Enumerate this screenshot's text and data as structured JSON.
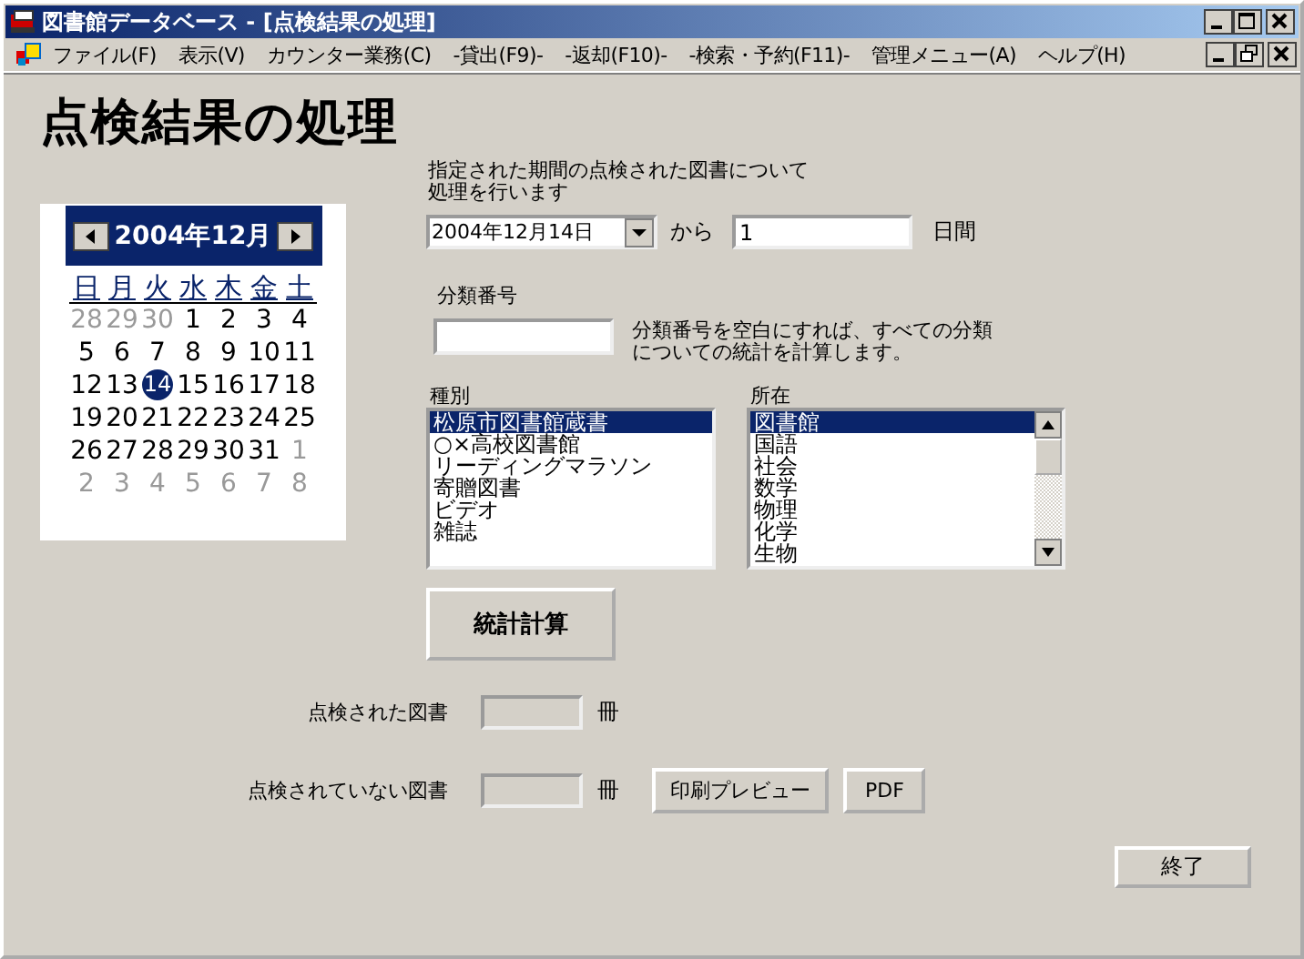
{
  "window": {
    "title": "図書館データベース - [点検結果の処理]"
  },
  "menu": [
    "ファイル(F)",
    "表示(V)",
    "カウンター業務(C)",
    "-貸出(F9)-",
    "-返却(F10)-",
    "-検索・予約(F11)-",
    "管理メニュー(A)",
    "ヘルプ(H)"
  ],
  "heading": "点検結果の処理",
  "calendar": {
    "title": "2004年12月",
    "weekdays": [
      "日",
      "月",
      "火",
      "水",
      "木",
      "金",
      "土"
    ],
    "weeks": [
      [
        {
          "day": "28",
          "muted": true,
          "selected": false
        },
        {
          "day": "29",
          "muted": true,
          "selected": false
        },
        {
          "day": "30",
          "muted": true,
          "selected": false
        },
        {
          "day": "1",
          "muted": false,
          "selected": false
        },
        {
          "day": "2",
          "muted": false,
          "selected": false
        },
        {
          "day": "3",
          "muted": false,
          "selected": false
        },
        {
          "day": "4",
          "muted": false,
          "selected": false
        }
      ],
      [
        {
          "day": "5",
          "muted": false,
          "selected": false
        },
        {
          "day": "6",
          "muted": false,
          "selected": false
        },
        {
          "day": "7",
          "muted": false,
          "selected": false
        },
        {
          "day": "8",
          "muted": false,
          "selected": false
        },
        {
          "day": "9",
          "muted": false,
          "selected": false
        },
        {
          "day": "10",
          "muted": false,
          "selected": false
        },
        {
          "day": "11",
          "muted": false,
          "selected": false
        }
      ],
      [
        {
          "day": "12",
          "muted": false,
          "selected": false
        },
        {
          "day": "13",
          "muted": false,
          "selected": false
        },
        {
          "day": "14",
          "muted": false,
          "selected": true
        },
        {
          "day": "15",
          "muted": false,
          "selected": false
        },
        {
          "day": "16",
          "muted": false,
          "selected": false
        },
        {
          "day": "17",
          "muted": false,
          "selected": false
        },
        {
          "day": "18",
          "muted": false,
          "selected": false
        }
      ],
      [
        {
          "day": "19",
          "muted": false,
          "selected": false
        },
        {
          "day": "20",
          "muted": false,
          "selected": false
        },
        {
          "day": "21",
          "muted": false,
          "selected": false
        },
        {
          "day": "22",
          "muted": false,
          "selected": false
        },
        {
          "day": "23",
          "muted": false,
          "selected": false
        },
        {
          "day": "24",
          "muted": false,
          "selected": false
        },
        {
          "day": "25",
          "muted": false,
          "selected": false
        }
      ],
      [
        {
          "day": "26",
          "muted": false,
          "selected": false
        },
        {
          "day": "27",
          "muted": false,
          "selected": false
        },
        {
          "day": "28",
          "muted": false,
          "selected": false
        },
        {
          "day": "29",
          "muted": false,
          "selected": false
        },
        {
          "day": "30",
          "muted": false,
          "selected": false
        },
        {
          "day": "31",
          "muted": false,
          "selected": false
        },
        {
          "day": "1",
          "muted": true,
          "selected": false
        }
      ],
      [
        {
          "day": "2",
          "muted": true,
          "selected": false
        },
        {
          "day": "3",
          "muted": true,
          "selected": false
        },
        {
          "day": "4",
          "muted": true,
          "selected": false
        },
        {
          "day": "5",
          "muted": true,
          "selected": false
        },
        {
          "day": "6",
          "muted": true,
          "selected": false
        },
        {
          "day": "7",
          "muted": true,
          "selected": false
        },
        {
          "day": "8",
          "muted": true,
          "selected": false
        }
      ]
    ]
  },
  "intro": [
    "指定された期間の点検された図書について",
    "処理を行います"
  ],
  "date_field": {
    "value": "2004年12月14日"
  },
  "from_label": "から",
  "days_field": {
    "value": "1"
  },
  "days_label": "日間",
  "classification": {
    "label": "分類番号",
    "note": [
      "分類番号を空白にすれば、すべての分類",
      "についての統計を計算します。"
    ]
  },
  "type_list": {
    "label": "種別",
    "items": [
      {
        "text": "松原市図書館蔵書",
        "selected": true
      },
      {
        "text": "○×高校図書館",
        "selected": false
      },
      {
        "text": "リーディングマラソン",
        "selected": false
      },
      {
        "text": "寄贈図書",
        "selected": false
      },
      {
        "text": "ビデオ",
        "selected": false
      },
      {
        "text": "雑誌",
        "selected": false
      }
    ]
  },
  "location_list": {
    "label": "所在",
    "items": [
      {
        "text": "図書館",
        "selected": true
      },
      {
        "text": "国語",
        "selected": false
      },
      {
        "text": "社会",
        "selected": false
      },
      {
        "text": "数学",
        "selected": false
      },
      {
        "text": "物理",
        "selected": false
      },
      {
        "text": "化学",
        "selected": false
      },
      {
        "text": "生物",
        "selected": false
      }
    ]
  },
  "calc_button": "統計計算",
  "counts": [
    {
      "label": "点検された図書",
      "unit": "冊"
    },
    {
      "label": "点検されていない図書",
      "unit": "冊"
    }
  ],
  "buttons": [
    "印刷プレビュー",
    "PDF"
  ],
  "exit_button": "終了"
}
